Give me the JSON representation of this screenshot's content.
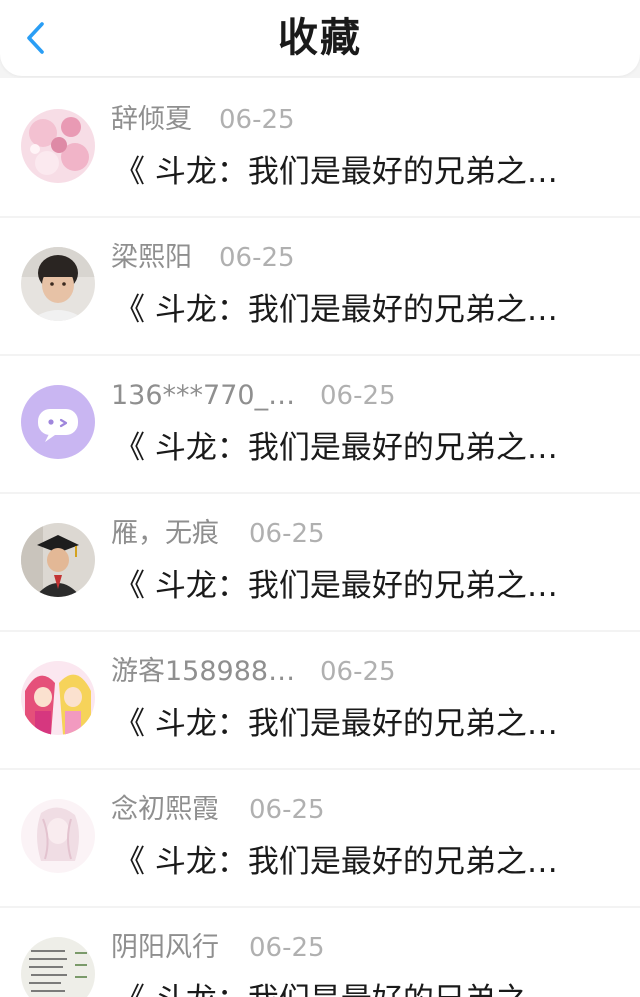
{
  "header": {
    "title": "收藏",
    "back_icon": "chevron-left-icon",
    "accent": "#2a9ef5"
  },
  "items": [
    {
      "user": "辞倾夏",
      "date": "06-25",
      "snippet": "《 斗龙：我们是最好的兄弟之…",
      "avatar": "pink-floral-avatar"
    },
    {
      "user": "梁熙阳",
      "date": "06-25",
      "snippet": "《 斗龙：我们是最好的兄弟之…",
      "avatar": "child-photo-avatar"
    },
    {
      "user": "136***770_…",
      "date": "06-25",
      "snippet": "《 斗龙：我们是最好的兄弟之…",
      "avatar": "purple-chat-default-avatar"
    },
    {
      "user": "雁，无痕",
      "date": "06-25",
      "snippet": "《 斗龙：我们是最好的兄弟之…",
      "avatar": "graduate-photo-avatar"
    },
    {
      "user": "游客158988…",
      "date": "06-25",
      "snippet": "《 斗龙：我们是最好的兄弟之…",
      "avatar": "anime-girls-avatar"
    },
    {
      "user": "念初熙霞",
      "date": "06-25",
      "snippet": "《 斗龙：我们是最好的兄弟之…",
      "avatar": "faded-sketch-avatar"
    },
    {
      "user": "阴阳风行",
      "date": "06-25",
      "snippet": "《 斗龙：我们是最好的兄弟之…",
      "avatar": "handwriting-avatar"
    }
  ]
}
